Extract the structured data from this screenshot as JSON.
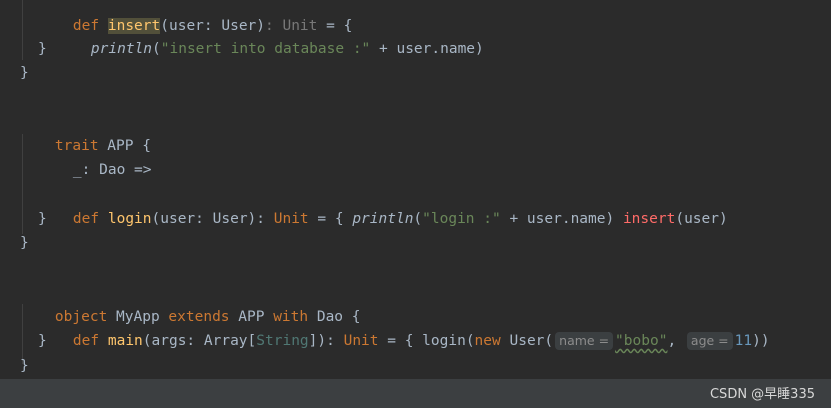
{
  "code": {
    "l0": {
      "kw": "def",
      "fn": "insert",
      "rest": "(user: User)",
      "type_hint": ": Unit",
      "tail": " = {"
    },
    "l1": {
      "call": "println",
      "open": "(",
      "str": "\"insert into database :\"",
      "rest": " + user.name)"
    },
    "l2": {
      "text": "}"
    },
    "l3": {
      "text": "}"
    },
    "l5": {
      "kw": "trait",
      "rest": " APP {"
    },
    "l6": {
      "text": "_: Dao =>"
    },
    "l8": {
      "kw": "def",
      "fn": "login",
      "rest1": "(user: User): ",
      "type": "Unit",
      "rest2": " = { ",
      "call": "println",
      "open": "(",
      "str": "\"login :\"",
      "rest3": " + user.name) ",
      "call2": "insert",
      "rest4": "(user)"
    },
    "l9": {
      "text": "}"
    },
    "l10": {
      "text": "}"
    },
    "l12": {
      "kw1": "object",
      "name": " MyApp ",
      "kw2": "extends",
      "mid": " APP ",
      "kw3": "with",
      "rest": " Dao {"
    },
    "l13": {
      "kw": "def",
      "fn": "main",
      "rest1": "(args: Array[",
      "typesq": "String",
      "rest2": "]): ",
      "type": "Unit",
      "rest3": " = { login(",
      "kwnew": "new",
      "rest4": " User(",
      "hint1": "name =",
      "str": "\"bobo\"",
      "comma": ", ",
      "hint2": "age =",
      "num": "11",
      "end": "))"
    },
    "l14": {
      "text": "}"
    },
    "l15": {
      "text": "}"
    }
  },
  "watermark": "CSDN @早睡335",
  "colors": {
    "background": "#2b2b2b",
    "keyword": "#cc7832",
    "function": "#ffc66d",
    "string": "#6a8759",
    "number": "#6897bb",
    "error": "#ff6b68"
  }
}
